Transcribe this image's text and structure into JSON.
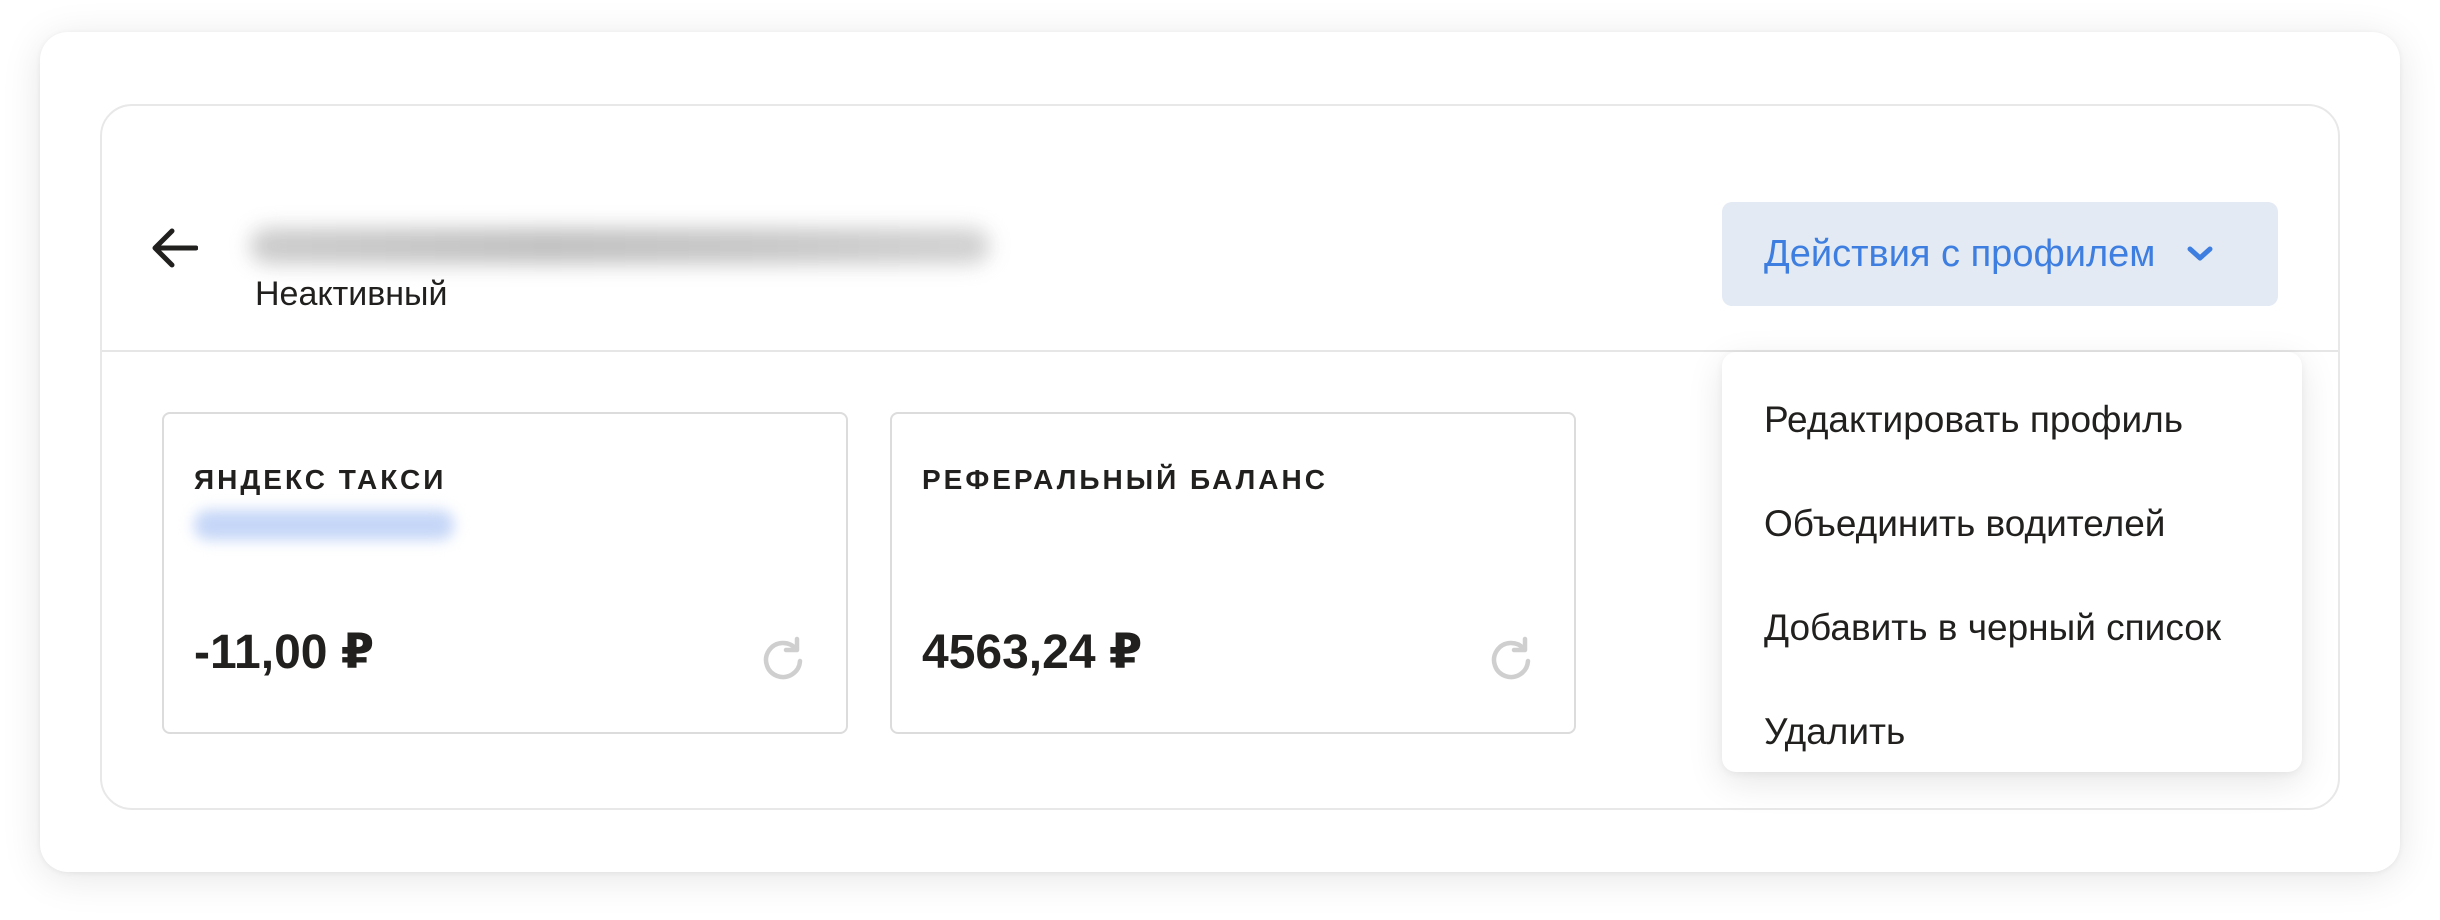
{
  "header": {
    "status": "Неактивный",
    "actions_label": "Действия с профилем"
  },
  "dropdown": {
    "items": [
      {
        "label": "Редактировать профиль"
      },
      {
        "label": "Объединить водителей"
      },
      {
        "label": "Добавить в черный список"
      },
      {
        "label": "Удалить"
      }
    ]
  },
  "balances": [
    {
      "title": "ЯНДЕКС ТАКСИ",
      "value": "-11,00 ₽"
    },
    {
      "title": "РЕФЕРАЛЬНЫЙ БАЛАНС",
      "value": "4563,24 ₽"
    }
  ],
  "icons": {
    "back": "arrow-left-icon",
    "chevron": "chevron-down-icon",
    "refresh": "refresh-icon"
  },
  "colors": {
    "accent": "#3d7ee0",
    "button_bg": "#e3eaf4",
    "text": "#21201f",
    "muted_icon": "#cfcfcf"
  }
}
